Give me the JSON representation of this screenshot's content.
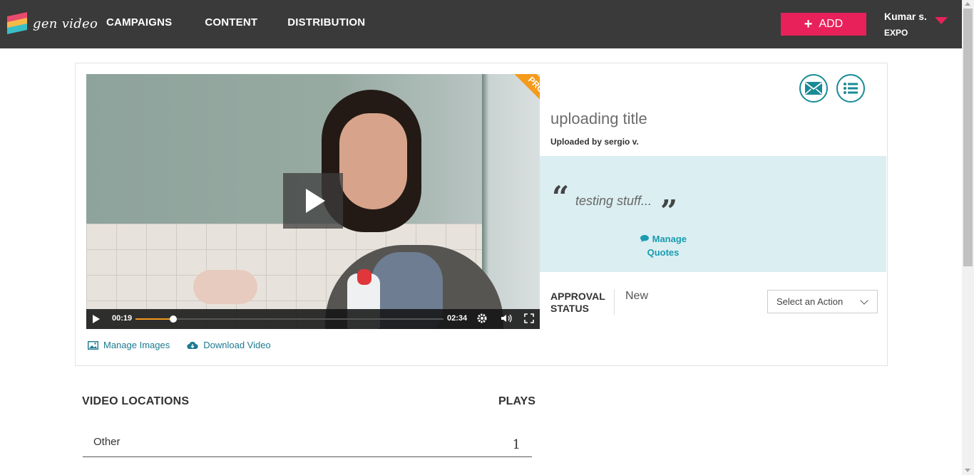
{
  "header": {
    "logo_text": "gen video",
    "nav": [
      "CAMPAIGNS",
      "CONTENT",
      "DISTRIBUTION"
    ],
    "add_label": "ADD",
    "user_name": "Kumar s.",
    "user_org": "EXPO"
  },
  "video": {
    "badge": "PRO",
    "current_time": "00:19",
    "duration": "02:34",
    "progress": 0.123
  },
  "media_links": {
    "manage_images": "Manage Images",
    "download_video": "Download Video"
  },
  "details": {
    "title": "uploading title",
    "uploaded_by": "Uploaded by sergio v.",
    "quote_open": "“",
    "quote_text": "testing stuff...",
    "quote_close": "”",
    "manage_quotes": "Manage Quotes",
    "approval_label": "APPROVAL STATUS",
    "approval_value": "New",
    "action_placeholder": "Select an Action"
  },
  "locations": {
    "heading": "VIDEO LOCATIONS",
    "plays_heading": "PLAYS",
    "rows": [
      {
        "name": "Other",
        "plays": "1"
      }
    ]
  },
  "colors": {
    "header_bg": "#3a3a3a",
    "accent_pink": "#e8215a",
    "teal": "#1a8b95",
    "quote_bg": "#dbeef2",
    "pro_orange": "#f49a1d"
  }
}
